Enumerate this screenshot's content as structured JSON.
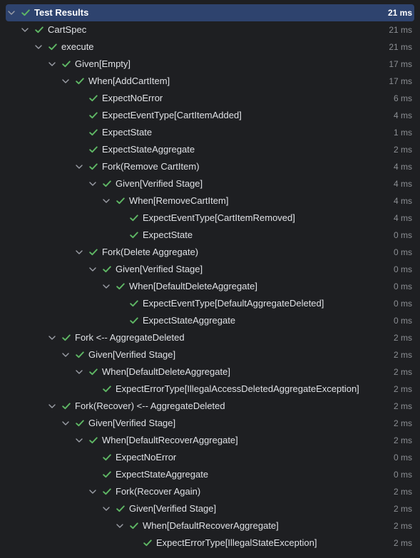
{
  "panel": {
    "rows": [
      {
        "label": "Test Results",
        "duration": "21 ms",
        "depth": 0,
        "expandable": true,
        "selected": true
      },
      {
        "label": "CartSpec",
        "duration": "21 ms",
        "depth": 1,
        "expandable": true
      },
      {
        "label": "execute",
        "duration": "21 ms",
        "depth": 2,
        "expandable": true
      },
      {
        "label": "Given[Empty]",
        "duration": "17 ms",
        "depth": 3,
        "expandable": true
      },
      {
        "label": "When[AddCartItem]",
        "duration": "17 ms",
        "depth": 4,
        "expandable": true
      },
      {
        "label": "ExpectNoError",
        "duration": "6 ms",
        "depth": 5,
        "expandable": false
      },
      {
        "label": "ExpectEventType[CartItemAdded]",
        "duration": "4 ms",
        "depth": 5,
        "expandable": false
      },
      {
        "label": "ExpectState",
        "duration": "1 ms",
        "depth": 5,
        "expandable": false
      },
      {
        "label": "ExpectStateAggregate",
        "duration": "2 ms",
        "depth": 5,
        "expandable": false
      },
      {
        "label": "Fork(Remove CartItem)",
        "duration": "4 ms",
        "depth": 5,
        "expandable": true
      },
      {
        "label": "Given[Verified Stage]",
        "duration": "4 ms",
        "depth": 6,
        "expandable": true
      },
      {
        "label": "When[RemoveCartItem]",
        "duration": "4 ms",
        "depth": 7,
        "expandable": true
      },
      {
        "label": "ExpectEventType[CartItemRemoved]",
        "duration": "4 ms",
        "depth": 8,
        "expandable": false
      },
      {
        "label": "ExpectState",
        "duration": "0 ms",
        "depth": 8,
        "expandable": false
      },
      {
        "label": "Fork(Delete Aggregate)",
        "duration": "0 ms",
        "depth": 5,
        "expandable": true
      },
      {
        "label": "Given[Verified Stage]",
        "duration": "0 ms",
        "depth": 6,
        "expandable": true
      },
      {
        "label": "When[DefaultDeleteAggregate]",
        "duration": "0 ms",
        "depth": 7,
        "expandable": true
      },
      {
        "label": "ExpectEventType[DefaultAggregateDeleted]",
        "duration": "0 ms",
        "depth": 8,
        "expandable": false
      },
      {
        "label": "ExpectStateAggregate",
        "duration": "0 ms",
        "depth": 8,
        "expandable": false
      },
      {
        "label": "Fork <-- AggregateDeleted",
        "duration": "2 ms",
        "depth": 3,
        "expandable": true
      },
      {
        "label": "Given[Verified Stage]",
        "duration": "2 ms",
        "depth": 4,
        "expandable": true
      },
      {
        "label": "When[DefaultDeleteAggregate]",
        "duration": "2 ms",
        "depth": 5,
        "expandable": true
      },
      {
        "label": "ExpectErrorType[IllegalAccessDeletedAggregateException]",
        "duration": "2 ms",
        "depth": 6,
        "expandable": false
      },
      {
        "label": "Fork(Recover) <-- AggregateDeleted",
        "duration": "2 ms",
        "depth": 3,
        "expandable": true
      },
      {
        "label": "Given[Verified Stage]",
        "duration": "2 ms",
        "depth": 4,
        "expandable": true
      },
      {
        "label": "When[DefaultRecoverAggregate]",
        "duration": "2 ms",
        "depth": 5,
        "expandable": true
      },
      {
        "label": "ExpectNoError",
        "duration": "0 ms",
        "depth": 6,
        "expandable": false
      },
      {
        "label": "ExpectStateAggregate",
        "duration": "0 ms",
        "depth": 6,
        "expandable": false
      },
      {
        "label": "Fork(Recover Again)",
        "duration": "2 ms",
        "depth": 6,
        "expandable": true
      },
      {
        "label": "Given[Verified Stage]",
        "duration": "2 ms",
        "depth": 7,
        "expandable": true
      },
      {
        "label": "When[DefaultRecoverAggregate]",
        "duration": "2 ms",
        "depth": 8,
        "expandable": true
      },
      {
        "label": "ExpectErrorType[IllegalStateException]",
        "duration": "2 ms",
        "depth": 9,
        "expandable": false
      }
    ]
  },
  "icons": {
    "expand": "chevron-down-icon",
    "passed": "check-passed-icon"
  },
  "colors": {
    "background": "#1e1f22",
    "selection": "#2e436e",
    "passed": "#5fb865",
    "text": "#dfe1e5",
    "duration": "#8c8f94",
    "chevron": "#9da0a8"
  }
}
